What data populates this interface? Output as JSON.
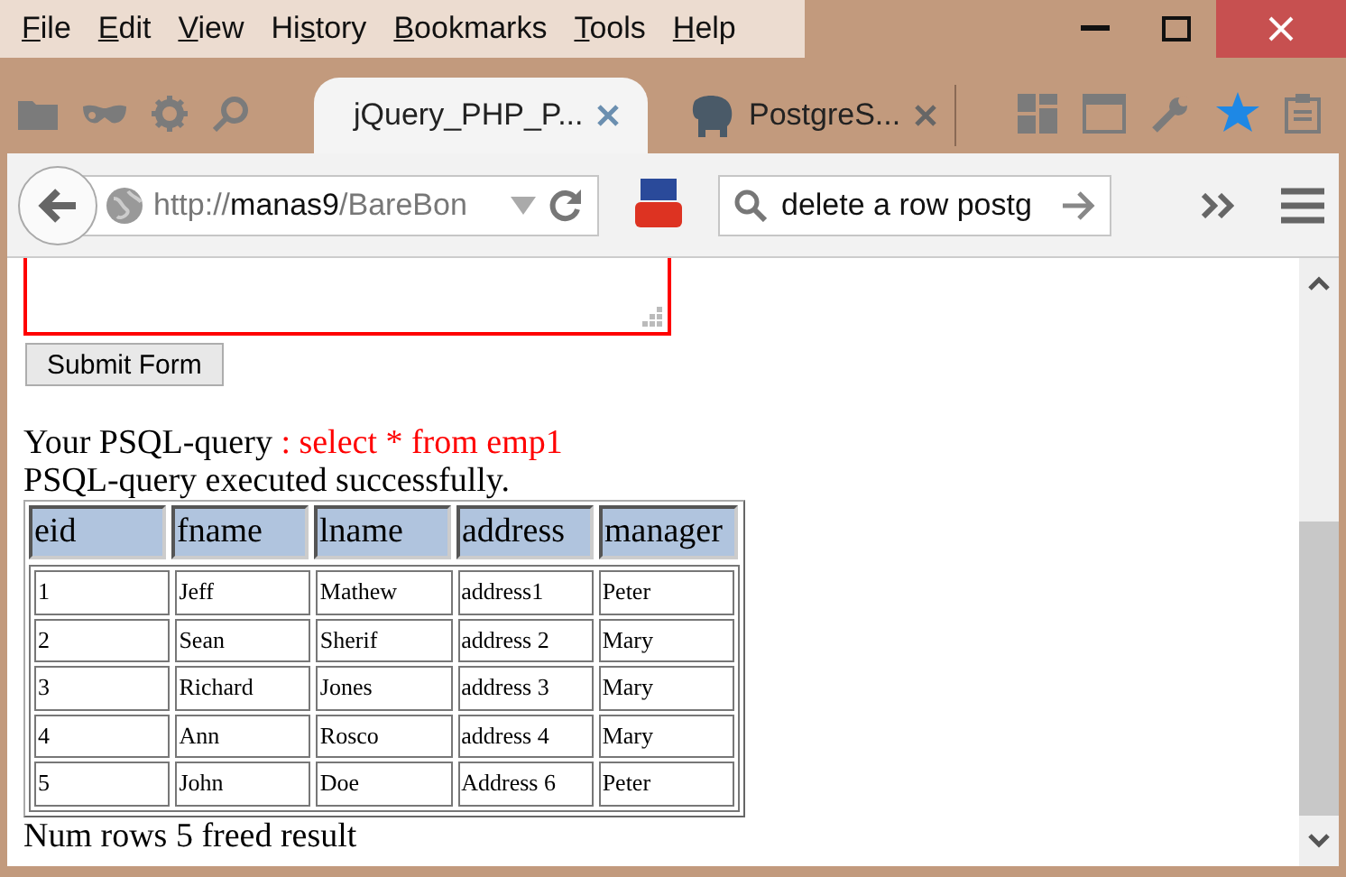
{
  "menu": [
    {
      "access_key": "F",
      "rest": "ile"
    },
    {
      "access_key": "E",
      "rest": "dit"
    },
    {
      "access_key": "V",
      "rest": "iew"
    },
    {
      "before": "Hi",
      "access_key": "s",
      "rest": "tory"
    },
    {
      "access_key": "B",
      "rest": "ookmarks"
    },
    {
      "access_key": "T",
      "rest": "ools"
    },
    {
      "access_key": "H",
      "rest": "elp"
    }
  ],
  "tabs": [
    {
      "title": "jQuery_PHP_P...",
      "selected": true,
      "kind": "page"
    },
    {
      "title": "PostgreS...",
      "selected": false,
      "kind": "elephant"
    }
  ],
  "address": {
    "scheme": "http://",
    "host": "manas9",
    "path": "/BareBon"
  },
  "search": {
    "value": "delete a row postg"
  },
  "page": {
    "submit_button": "Submit Form",
    "query_label": "Your PSQL-query",
    "query_text": " : select * from emp1",
    "status": "PSQL-query executed successfully.",
    "table": {
      "columns": [
        "eid",
        "fname",
        "lname",
        "address",
        "manager"
      ],
      "rows": [
        [
          "1",
          "Jeff",
          "Mathew",
          "address1",
          "Peter"
        ],
        [
          "2",
          "Sean",
          "Sherif",
          "address 2",
          "Mary"
        ],
        [
          "3",
          "Richard",
          "Jones",
          "address 3",
          "Mary"
        ],
        [
          "4",
          "Ann",
          "Rosco",
          "address 4",
          "Mary"
        ],
        [
          "5",
          "John",
          "Doe",
          "Address 6",
          "Peter"
        ]
      ]
    },
    "footer": "Num rows 5 freed result"
  }
}
